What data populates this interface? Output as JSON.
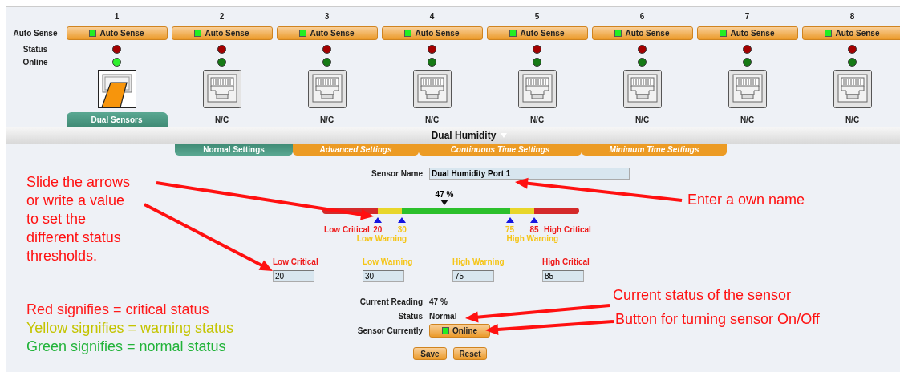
{
  "row_labels": [
    "Auto Sense",
    "Status",
    "Online"
  ],
  "ports": [
    {
      "number": "1",
      "auto_sense": "Auto Sense",
      "auto_sense_on": true,
      "alarm": true,
      "online": true,
      "connected": true,
      "label": "Dual Sensors",
      "selected": true
    },
    {
      "number": "2",
      "auto_sense": "Auto Sense",
      "auto_sense_on": true,
      "alarm": true,
      "online": false,
      "connected": false,
      "label": "N/C",
      "selected": false
    },
    {
      "number": "3",
      "auto_sense": "Auto Sense",
      "auto_sense_on": true,
      "alarm": true,
      "online": false,
      "connected": false,
      "label": "N/C",
      "selected": false
    },
    {
      "number": "4",
      "auto_sense": "Auto Sense",
      "auto_sense_on": true,
      "alarm": true,
      "online": false,
      "connected": false,
      "label": "N/C",
      "selected": false
    },
    {
      "number": "5",
      "auto_sense": "Auto Sense",
      "auto_sense_on": true,
      "alarm": true,
      "online": false,
      "connected": false,
      "label": "N/C",
      "selected": false
    },
    {
      "number": "6",
      "auto_sense": "Auto Sense",
      "auto_sense_on": true,
      "alarm": true,
      "online": false,
      "connected": false,
      "label": "N/C",
      "selected": false
    },
    {
      "number": "7",
      "auto_sense": "Auto Sense",
      "auto_sense_on": true,
      "alarm": true,
      "online": false,
      "connected": false,
      "label": "N/C",
      "selected": false
    },
    {
      "number": "8",
      "auto_sense": "Auto Sense",
      "auto_sense_on": true,
      "alarm": true,
      "online": false,
      "connected": false,
      "label": "N/C",
      "selected": false
    }
  ],
  "sensor_title": "Dual Humidity",
  "settings_tabs": [
    {
      "label": "Normal Settings",
      "selected": true
    },
    {
      "label": "Advanced Settings",
      "selected": false
    },
    {
      "label": "Continuous Time Settings",
      "selected": false
    },
    {
      "label": "Minimum Time Settings",
      "selected": false
    }
  ],
  "sensor_name": {
    "label": "Sensor Name",
    "value": "Dual Humidity Port 1"
  },
  "gauge": {
    "reading": "47 %",
    "thresholds": [
      {
        "name": "Low Critical",
        "value": "20",
        "kind": "critical"
      },
      {
        "name": "Low Warning",
        "value": "30",
        "kind": "warning"
      },
      {
        "name": "High Warning",
        "value": "75",
        "kind": "warning"
      },
      {
        "name": "High Critical",
        "value": "85",
        "kind": "critical"
      }
    ]
  },
  "threshold_fields": [
    {
      "label": "Low Critical",
      "value": "20",
      "kind": "critical"
    },
    {
      "label": "Low Warning",
      "value": "30",
      "kind": "warning"
    },
    {
      "label": "High Warning",
      "value": "75",
      "kind": "warning"
    },
    {
      "label": "High Critical",
      "value": "85",
      "kind": "critical"
    }
  ],
  "readings": [
    {
      "label": "Current Reading",
      "value": "47 %"
    },
    {
      "label": "Status",
      "value": "Normal"
    }
  ],
  "sensor_currently": {
    "label": "Sensor Currently",
    "button": "Online",
    "on": true
  },
  "buttons": [
    "Save",
    "Reset"
  ],
  "callouts": [
    "Slide the arrows or write a value to set the different status thresholds.",
    "Enter a own name",
    "Current status of the sensor",
    "Button for turning sensor On/Off"
  ],
  "legend": [
    {
      "text": "Red signifies = critical status",
      "kind": "critical"
    },
    {
      "text": "Yellow signifies = warning status",
      "kind": "warning"
    },
    {
      "text": "Green signifies = normal status",
      "kind": "normal"
    }
  ]
}
